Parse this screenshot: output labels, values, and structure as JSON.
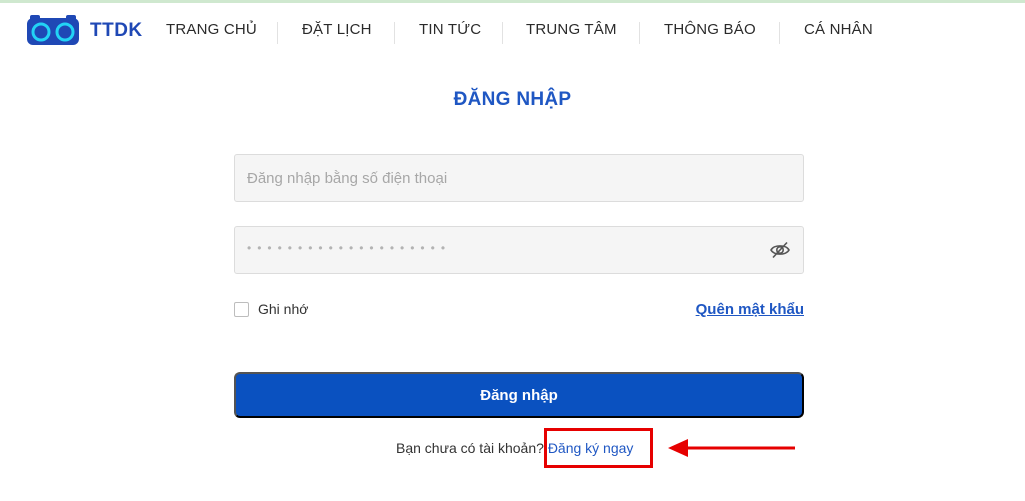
{
  "brand": {
    "name": "TTDK"
  },
  "nav": {
    "items": [
      {
        "label": "TRANG CHỦ"
      },
      {
        "label": "ĐẶT LỊCH"
      },
      {
        "label": "TIN TỨC"
      },
      {
        "label": "TRUNG TÂM"
      },
      {
        "label": "THÔNG BÁO"
      },
      {
        "label": "CÁ NHÂN"
      }
    ]
  },
  "login": {
    "title": "ĐĂNG NHẬP",
    "phone_placeholder": "Đăng nhập bằng số điện thoại",
    "phone_value": "",
    "password_mask": "••••••••••••••••••••",
    "remember_label": "Ghi nhớ",
    "remember_checked": false,
    "forgot_label": "Quên mật khẩu",
    "submit_label": "Đăng nhập",
    "no_account_text": "Bạn chưa có tài khoản?",
    "signup_label": "Đăng ký ngay"
  },
  "colors": {
    "accent": "#0a51c0",
    "brand": "#1f48b5",
    "annotation": "#e60000"
  },
  "icons": {
    "logo": "ttdk-logo-icon",
    "password_toggle": "eye-slash-icon",
    "annotation_arrow": "left-arrow-icon"
  }
}
